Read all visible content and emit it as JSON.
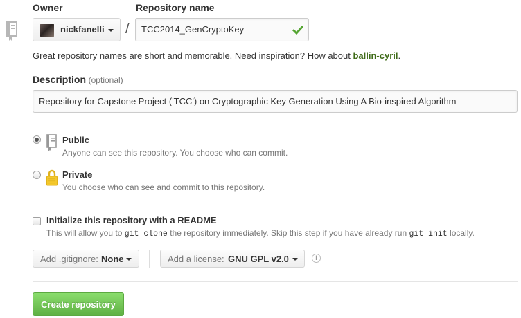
{
  "owner": {
    "label": "Owner",
    "username": "nickfanelli"
  },
  "repo": {
    "label": "Repository name",
    "name": "TCC2014_GenCryptoKey",
    "separator": "/"
  },
  "hint": {
    "text": "Great repository names are short and memorable. Need inspiration? How about",
    "suggestion": "ballin-cyril",
    "end": "."
  },
  "description": {
    "label": "Description",
    "optional": "(optional)",
    "value": "Repository for Capstone Project ('TCC') on Cryptographic Key Generation Using A Bio-inspired Algorithm"
  },
  "visibility": {
    "selected": "public",
    "public": {
      "title": "Public",
      "desc": "Anyone can see this repository. You choose who can commit."
    },
    "private": {
      "title": "Private",
      "desc": "You choose who can see and commit to this repository."
    }
  },
  "readme": {
    "checked": false,
    "title": "Initialize this repository with a README",
    "desc_1": "This will allow you to",
    "code_1": "git clone",
    "desc_2": "the repository immediately. Skip this step if you have already run",
    "code_2": "git init",
    "desc_3": "locally."
  },
  "gitignore": {
    "prefix": "Add .gitignore:",
    "value": "None"
  },
  "license": {
    "prefix": "Add a license:",
    "value": "GNU GPL v2.0"
  },
  "info_icon_glyph": "i",
  "submit_label": "Create repository",
  "colors": {
    "suggestion": "#3f6b18",
    "check": "#55a532",
    "button_top": "#8add6d",
    "button_bottom": "#60b044",
    "lock": "#f4c82c"
  }
}
